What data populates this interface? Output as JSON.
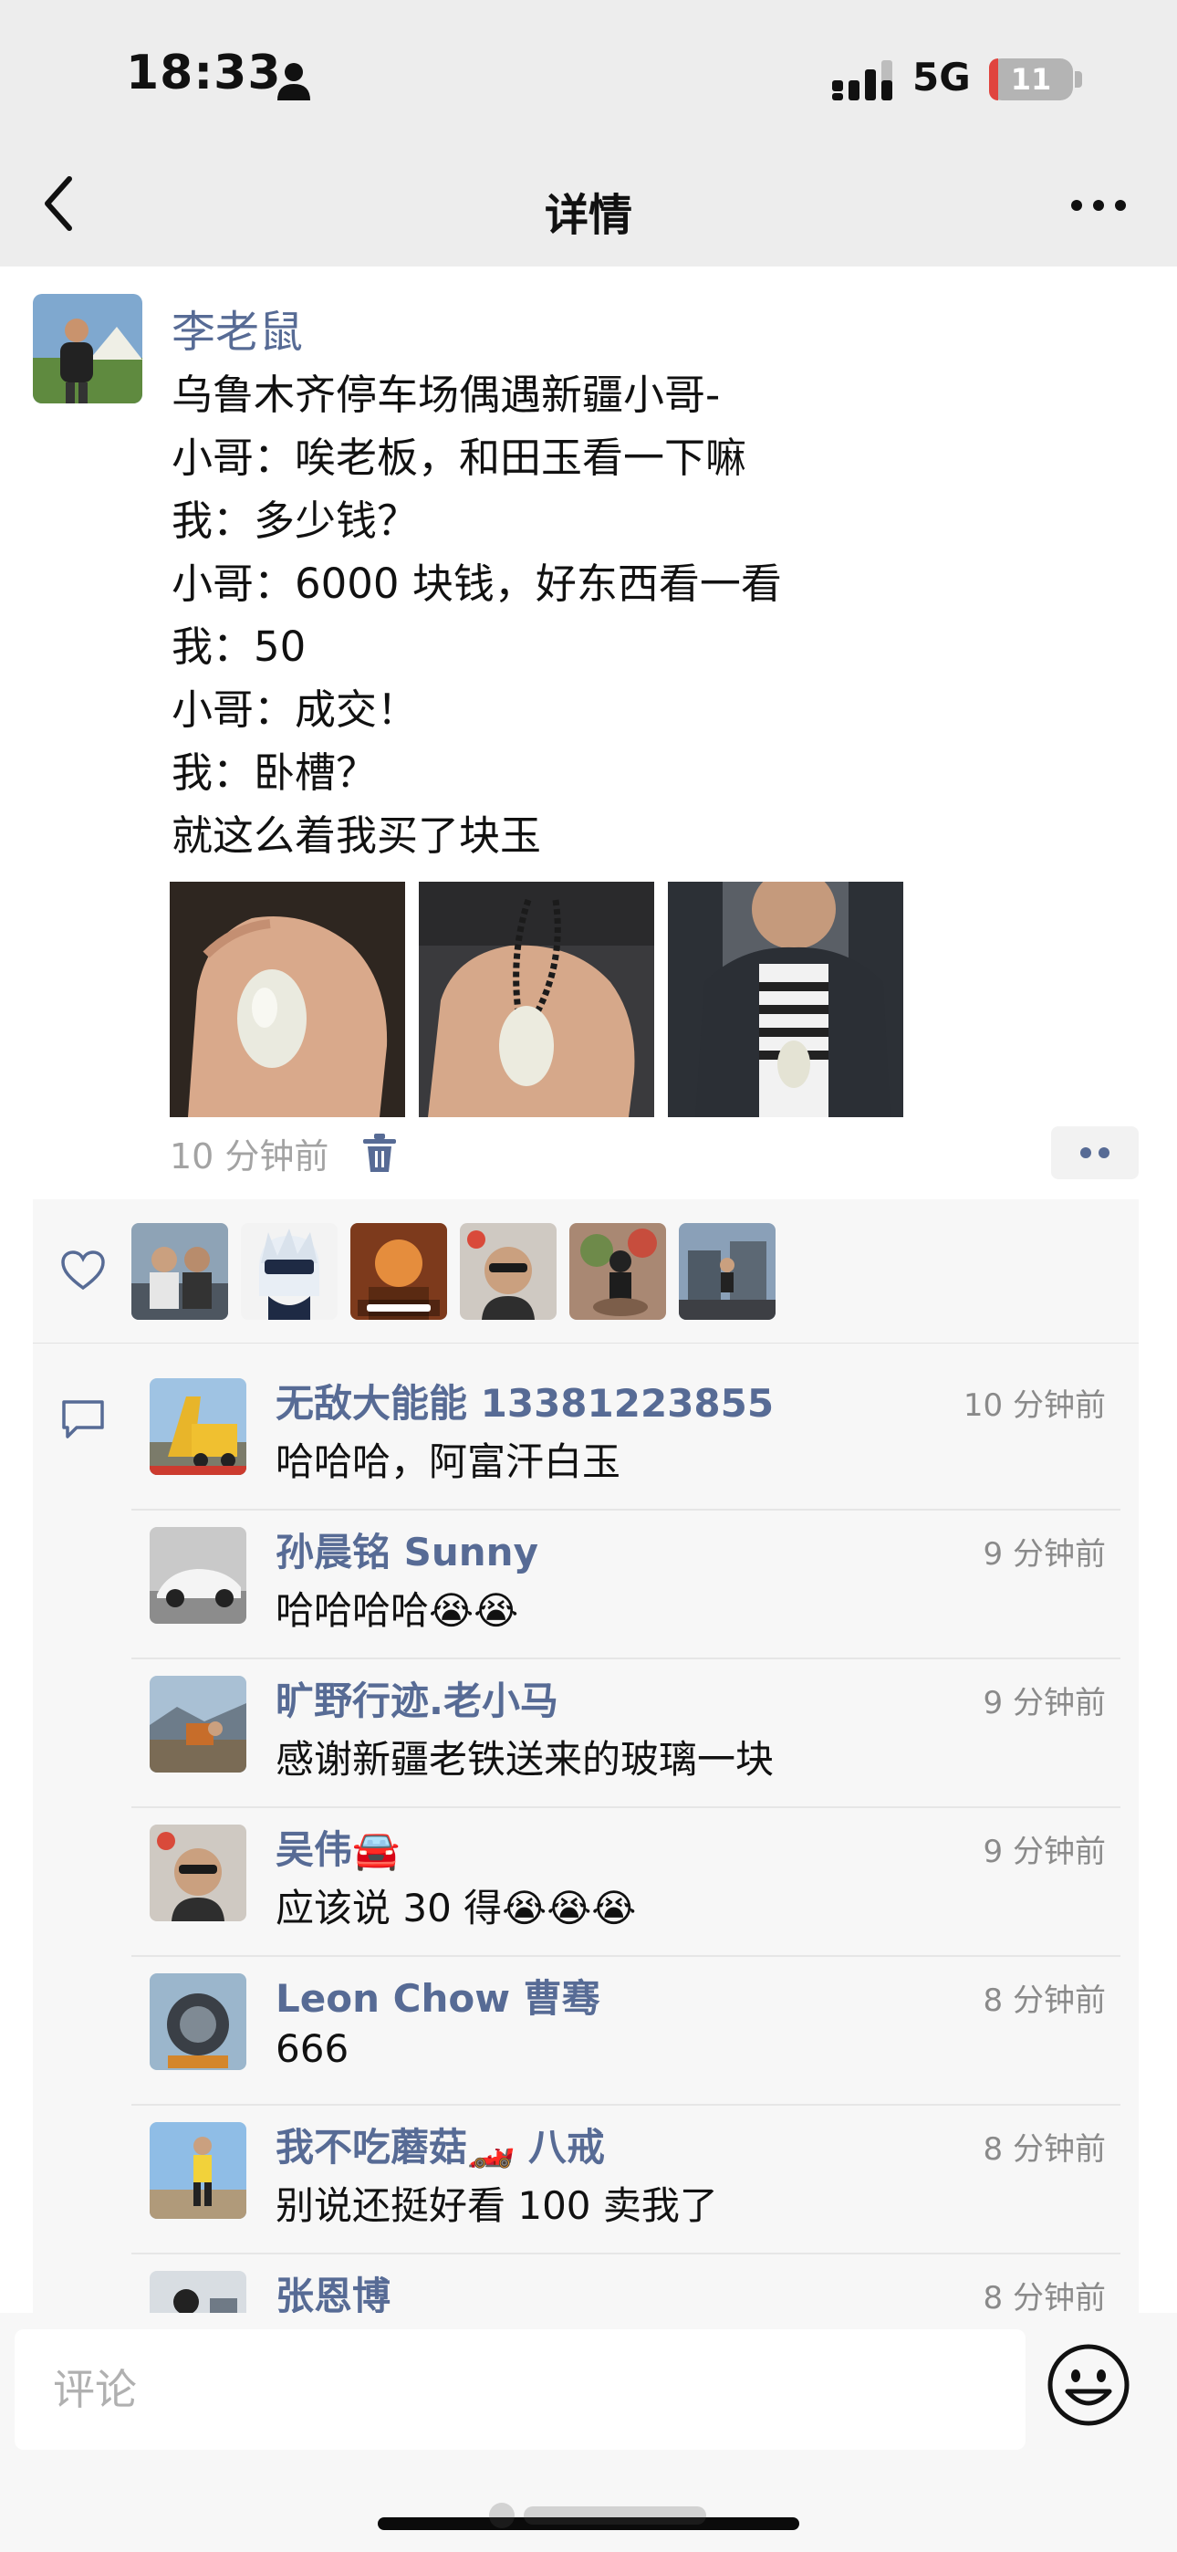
{
  "status_bar": {
    "time": "18:33",
    "network": "5G",
    "battery": "11",
    "battery_level": 0.11
  },
  "nav": {
    "title": "详情"
  },
  "post": {
    "author": "李老鼠",
    "lines": [
      "乌鲁木齐停车场偶遇新疆小哥-",
      "小哥：唉老板，和田玉看一下嘛",
      "我：多少钱？",
      "小哥：6000 块钱，好东西看一看",
      "我：50",
      "小哥：成交！",
      "我：卧槽？",
      "就这么着我买了块玉"
    ],
    "time": "10 分钟前"
  },
  "likes": {
    "count_avatars": 6
  },
  "comments": [
    {
      "name": "无敌大能能 13381223855",
      "time": "10 分钟前",
      "text": "哈哈哈，阿富汗白玉"
    },
    {
      "name": "孙晨铭 Sunny",
      "time": "9 分钟前",
      "text": "哈哈哈哈😭😭"
    },
    {
      "name": "旷野行迹.老小马",
      "time": "9 分钟前",
      "text": "感谢新疆老铁送来的玻璃一块"
    },
    {
      "name": "吴伟🚘",
      "time": "9 分钟前",
      "text": "应该说 30 得😭😭😭"
    },
    {
      "name": "Leon Chow 曹骞",
      "time": "8 分钟前",
      "text": "666"
    },
    {
      "name": "我不吃蘑菇🏎️ 八戒",
      "time": "8 分钟前",
      "text": "别说还挺好看 100 卖我了"
    },
    {
      "name": "张恩博",
      "time": "8 分钟前",
      "text": ""
    }
  ],
  "input": {
    "placeholder": "评论"
  },
  "colors": {
    "link_blue": "#576b95",
    "panel_bg": "#f7f7f7",
    "topbar_bg": "#ededed"
  }
}
